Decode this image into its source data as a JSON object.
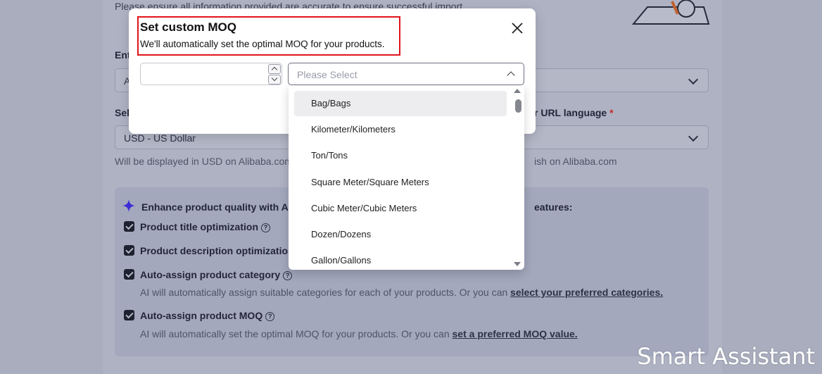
{
  "background": {
    "top_text": "Please ensure all information provided are accurate to ensure successful import",
    "label_left_1": "Ent",
    "select_left_1_value": "A",
    "label_left_2": "Sel",
    "label_right_2": "r URL language",
    "currency_value": "USD - US Dollar",
    "help_left": "Will be displayed in USD on Alibaba.com",
    "help_right": "ish on Alibaba.com",
    "enhance_title_left": "Enhance product quality with AI S",
    "enhance_title_right": "eatures:",
    "features": [
      {
        "label": "Product title optimization",
        "help": ""
      },
      {
        "label": "Product description optimization",
        "help": ""
      },
      {
        "label": "Auto-assign product category",
        "help": "AI will automatically assign suitable categories for each of your products. Or you can ",
        "link": "select your preferred categories."
      },
      {
        "label": "Auto-assign product MOQ",
        "help": "AI will automatically set the optimal MOQ for your products. Or you can ",
        "link": "set a preferred MOQ value."
      }
    ]
  },
  "modal": {
    "title": "Set custom MOQ",
    "subtitle": "We'll automatically set the optimal MOQ for your products.",
    "quantity_value": "",
    "unit_placeholder": "Please Select",
    "unit_options": [
      "Bag/Bags",
      "Kilometer/Kilometers",
      "Ton/Tons",
      "Square Meter/Square Meters",
      "Cubic Meter/Cubic Meters",
      "Dozen/Dozens",
      "Gallon/Gallons"
    ]
  },
  "colors": {
    "highlight": "#e0141b",
    "overlay": "#a9adbd",
    "sparkle": "#3b2bd6"
  },
  "watermark": "Smart Assistant"
}
